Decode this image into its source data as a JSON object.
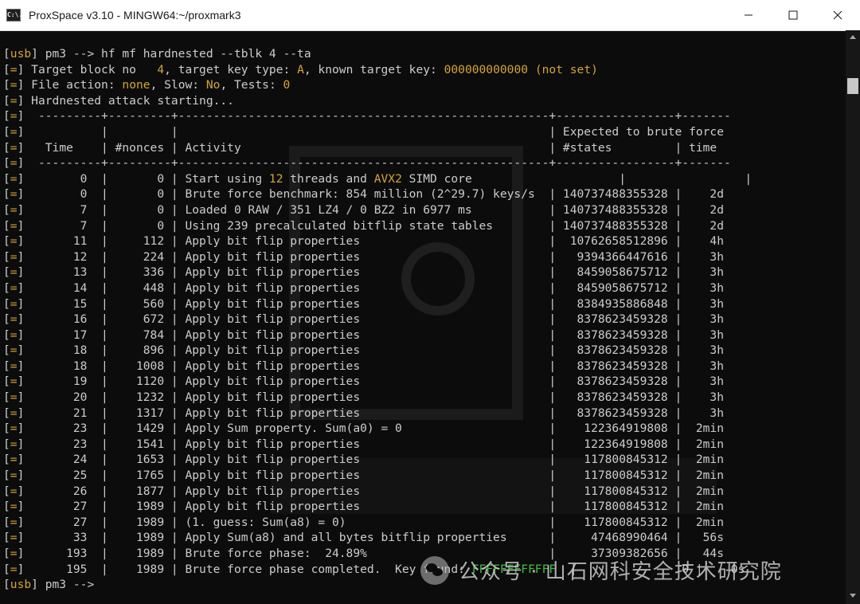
{
  "window": {
    "title": "ProxSpace v3.10 - MINGW64:~/proxmark3",
    "icon_label": "C:\\."
  },
  "colors": {
    "background": "#0c0c0c",
    "text": "#cccccc",
    "highlight": "#d4a437",
    "titlebar": "#ffffff"
  },
  "terminal": {
    "lines": [
      {
        "t": "cmd",
        "prompt": "usb",
        "pm": " pm3 --> ",
        "cmd": "hf mf hardnested --tblk 4 --ta"
      },
      {
        "t": "parts",
        "parts": [
          [
            "w",
            "Target block no   "
          ],
          [
            "y",
            "4"
          ],
          [
            "w",
            ", target key type: "
          ],
          [
            "y",
            "A"
          ],
          [
            "w",
            ", known target key: "
          ],
          [
            "y",
            "000000000000 (not set)"
          ]
        ]
      },
      {
        "t": "parts",
        "parts": [
          [
            "w",
            "File action: "
          ],
          [
            "y",
            "none"
          ],
          [
            "w",
            ", Slow: "
          ],
          [
            "y",
            "No"
          ],
          [
            "w",
            ", Tests: "
          ],
          [
            "y",
            "0"
          ]
        ]
      },
      {
        "t": "parts",
        "parts": [
          [
            "w",
            "Hardnested attack starting..."
          ]
        ]
      },
      {
        "t": "parts",
        "parts": [
          [
            "w",
            " ---------+---------+-----------------------------------------------------+-----------------+-------"
          ]
        ]
      },
      {
        "t": "parts",
        "parts": [
          [
            "w",
            "          |         |                                                     | Expected to brute force"
          ]
        ]
      },
      {
        "t": "parts",
        "parts": [
          [
            "w",
            "  Time    | #nonces | Activity                                            | #states         | time"
          ]
        ]
      },
      {
        "t": "parts",
        "parts": [
          [
            "w",
            " ---------+---------+-----------------------------------------------------+-----------------+-------"
          ]
        ]
      },
      {
        "t": "parts",
        "parts": [
          [
            "w",
            "       0  |       0 | Start using "
          ],
          [
            "y",
            "12"
          ],
          [
            "w",
            " threads and "
          ],
          [
            "y",
            "AVX2"
          ],
          [
            "w",
            " SIMD core                     |                 |"
          ]
        ]
      },
      {
        "t": "parts",
        "parts": [
          [
            "w",
            "       0  |       0 | Brute force benchmark: 854 million (2^29.7) keys/s  | 140737488355328 |    2d"
          ]
        ]
      },
      {
        "t": "parts",
        "parts": [
          [
            "w",
            "       7  |       0 | Loaded 0 RAW / 351 LZ4 / 0 BZ2 in 6977 ms           | 140737488355328 |    2d"
          ]
        ]
      },
      {
        "t": "parts",
        "parts": [
          [
            "w",
            "       7  |       0 | Using 239 precalculated bitflip state tables        | 140737488355328 |    2d"
          ]
        ]
      },
      {
        "t": "parts",
        "parts": [
          [
            "w",
            "      11  |     112 | Apply bit flip properties                           |  10762658512896 |    4h"
          ]
        ]
      },
      {
        "t": "parts",
        "parts": [
          [
            "w",
            "      12  |     224 | Apply bit flip properties                           |   9394366447616 |    3h"
          ]
        ]
      },
      {
        "t": "parts",
        "parts": [
          [
            "w",
            "      13  |     336 | Apply bit flip properties                           |   8459058675712 |    3h"
          ]
        ]
      },
      {
        "t": "parts",
        "parts": [
          [
            "w",
            "      14  |     448 | Apply bit flip properties                           |   8459058675712 |    3h"
          ]
        ]
      },
      {
        "t": "parts",
        "parts": [
          [
            "w",
            "      15  |     560 | Apply bit flip properties                           |   8384935886848 |    3h"
          ]
        ]
      },
      {
        "t": "parts",
        "parts": [
          [
            "w",
            "      16  |     672 | Apply bit flip properties                           |   8378623459328 |    3h"
          ]
        ]
      },
      {
        "t": "parts",
        "parts": [
          [
            "w",
            "      17  |     784 | Apply bit flip properties                           |   8378623459328 |    3h"
          ]
        ]
      },
      {
        "t": "parts",
        "parts": [
          [
            "w",
            "      18  |     896 | Apply bit flip properties                           |   8378623459328 |    3h"
          ]
        ]
      },
      {
        "t": "parts",
        "parts": [
          [
            "w",
            "      18  |    1008 | Apply bit flip properties                           |   8378623459328 |    3h"
          ]
        ]
      },
      {
        "t": "parts",
        "parts": [
          [
            "w",
            "      19  |    1120 | Apply bit flip properties                           |   8378623459328 |    3h"
          ]
        ]
      },
      {
        "t": "parts",
        "parts": [
          [
            "w",
            "      20  |    1232 | Apply bit flip properties                           |   8378623459328 |    3h"
          ]
        ]
      },
      {
        "t": "parts",
        "parts": [
          [
            "w",
            "      21  |    1317 | Apply bit flip properties                           |   8378623459328 |    3h"
          ]
        ]
      },
      {
        "t": "parts",
        "parts": [
          [
            "w",
            "      23  |    1429 | Apply Sum property. Sum(a0) = 0                     |    122364919808 |  2min"
          ]
        ]
      },
      {
        "t": "parts",
        "parts": [
          [
            "w",
            "      23  |    1541 | Apply bit flip properties                           |    122364919808 |  2min"
          ]
        ]
      },
      {
        "t": "parts",
        "parts": [
          [
            "w",
            "      24  |    1653 | Apply bit flip properties                           |    117800845312 |  2min"
          ]
        ]
      },
      {
        "t": "parts",
        "parts": [
          [
            "w",
            "      25  |    1765 | Apply bit flip properties                           |    117800845312 |  2min"
          ]
        ]
      },
      {
        "t": "parts",
        "parts": [
          [
            "w",
            "      26  |    1877 | Apply bit flip properties                           |    117800845312 |  2min"
          ]
        ]
      },
      {
        "t": "parts",
        "parts": [
          [
            "w",
            "      27  |    1989 | Apply bit flip properties                           |    117800845312 |  2min"
          ]
        ]
      },
      {
        "t": "parts",
        "parts": [
          [
            "w",
            "      27  |    1989 | (1. guess: Sum(a8) = 0)                             |    117800845312 |  2min"
          ]
        ]
      },
      {
        "t": "parts",
        "parts": [
          [
            "w",
            "      33  |    1989 | Apply Sum(a8) and all bytes bitflip properties      |     47468990464 |   56s"
          ]
        ]
      },
      {
        "t": "parts",
        "parts": [
          [
            "w",
            "     193  |    1989 | Brute force phase:  24.89%                          |     37309382656 |   44s"
          ]
        ]
      },
      {
        "t": "parts",
        "parts": [
          [
            "w",
            "     195  |    1989 | Brute force phase completed.  Key found: "
          ],
          [
            "g",
            "FFFFFFFFFFFF"
          ],
          [
            "w",
            "  |               0 |    0s"
          ]
        ]
      },
      {
        "t": "prompt",
        "prompt": "usb",
        "pm": " pm3 --> "
      }
    ]
  },
  "overlay": {
    "wechat_label": "公众号 · 山石网科安全技术研究院"
  }
}
